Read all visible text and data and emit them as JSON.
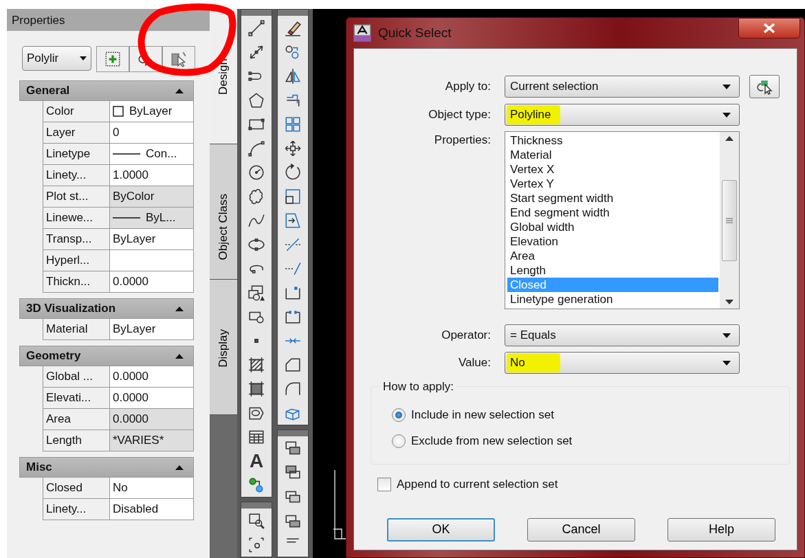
{
  "properties_panel": {
    "title": "Properties",
    "object_dropdown": "Polylir",
    "sections": [
      {
        "title": "General",
        "expanded": true,
        "rows": [
          {
            "label": "Color",
            "value": "ByLayer",
            "kind": "color",
            "editable": true
          },
          {
            "label": "Layer",
            "value": "0",
            "kind": "text",
            "editable": true
          },
          {
            "label": "Linetype",
            "value": "Con...",
            "kind": "linetype",
            "editable": true
          },
          {
            "label": "Linety...",
            "value": "1.0000",
            "kind": "text",
            "editable": true
          },
          {
            "label": "Plot st...",
            "value": "ByColor",
            "kind": "text",
            "editable": false
          },
          {
            "label": "Linewe...",
            "value": "ByL...",
            "kind": "linetype",
            "editable": false
          },
          {
            "label": "Transp...",
            "value": "ByLayer",
            "kind": "text",
            "editable": true
          },
          {
            "label": "Hyperl...",
            "kind": "text",
            "editable": true
          },
          {
            "label": "Thickn...",
            "value": "0.0000",
            "kind": "text",
            "editable": true
          }
        ]
      },
      {
        "title": "3D Visualization",
        "expanded": true,
        "rows": [
          {
            "label": "Material",
            "value": "ByLayer",
            "kind": "text",
            "editable": true
          }
        ]
      },
      {
        "title": "Geometry",
        "expanded": true,
        "rows": [
          {
            "label": "Global ...",
            "value": "0.0000",
            "kind": "text",
            "editable": true
          },
          {
            "label": "Elevati...",
            "value": "0.0000",
            "kind": "text",
            "editable": true
          },
          {
            "label": "Area",
            "value": "0.0000",
            "kind": "text",
            "editable": false
          },
          {
            "label": "Length",
            "value": "*VARIES*",
            "kind": "text",
            "editable": false
          }
        ]
      },
      {
        "title": "Misc",
        "expanded": true,
        "rows": [
          {
            "label": "Closed",
            "value": "No",
            "kind": "text",
            "editable": true
          },
          {
            "label": "Linety...",
            "value": "Disabled",
            "kind": "text",
            "editable": true
          }
        ]
      }
    ]
  },
  "side_tabs": [
    {
      "label": "Design",
      "selected": true
    },
    {
      "label": "Object Class",
      "selected": false
    },
    {
      "label": "Display",
      "selected": false
    }
  ],
  "toolbar_text_glyph": "A",
  "dialog": {
    "title": "Quick Select",
    "apply_to": {
      "label": "Apply to:",
      "value": "Current selection"
    },
    "object_type": {
      "label": "Object type:",
      "value": "Polyline",
      "highlighted": true
    },
    "properties_label": "Properties:",
    "properties": [
      {
        "label": "Thickness",
        "selected": false
      },
      {
        "label": "Material",
        "selected": false
      },
      {
        "label": "Vertex X",
        "selected": false
      },
      {
        "label": "Vertex Y",
        "selected": false
      },
      {
        "label": "Start segment width",
        "selected": false
      },
      {
        "label": "End segment width",
        "selected": false
      },
      {
        "label": "Global width",
        "selected": false
      },
      {
        "label": "Elevation",
        "selected": false
      },
      {
        "label": "Area",
        "selected": false
      },
      {
        "label": "Length",
        "selected": false
      },
      {
        "label": "Closed",
        "selected": true
      },
      {
        "label": "Linetype generation",
        "selected": false
      }
    ],
    "operator": {
      "label": "Operator:",
      "value": "= Equals"
    },
    "value": {
      "label": "Value:",
      "value": "No",
      "highlighted": true
    },
    "how_to_apply": {
      "title": "How to apply:",
      "options": [
        {
          "label": "Include in new selection set",
          "selected": true
        },
        {
          "label": "Exclude from new selection set",
          "selected": false
        }
      ]
    },
    "append": {
      "label": "Append to current selection set",
      "checked": false
    },
    "buttons": [
      {
        "label": "OK",
        "default": true
      },
      {
        "label": "Cancel",
        "default": false
      },
      {
        "label": "Help",
        "default": false
      }
    ]
  }
}
